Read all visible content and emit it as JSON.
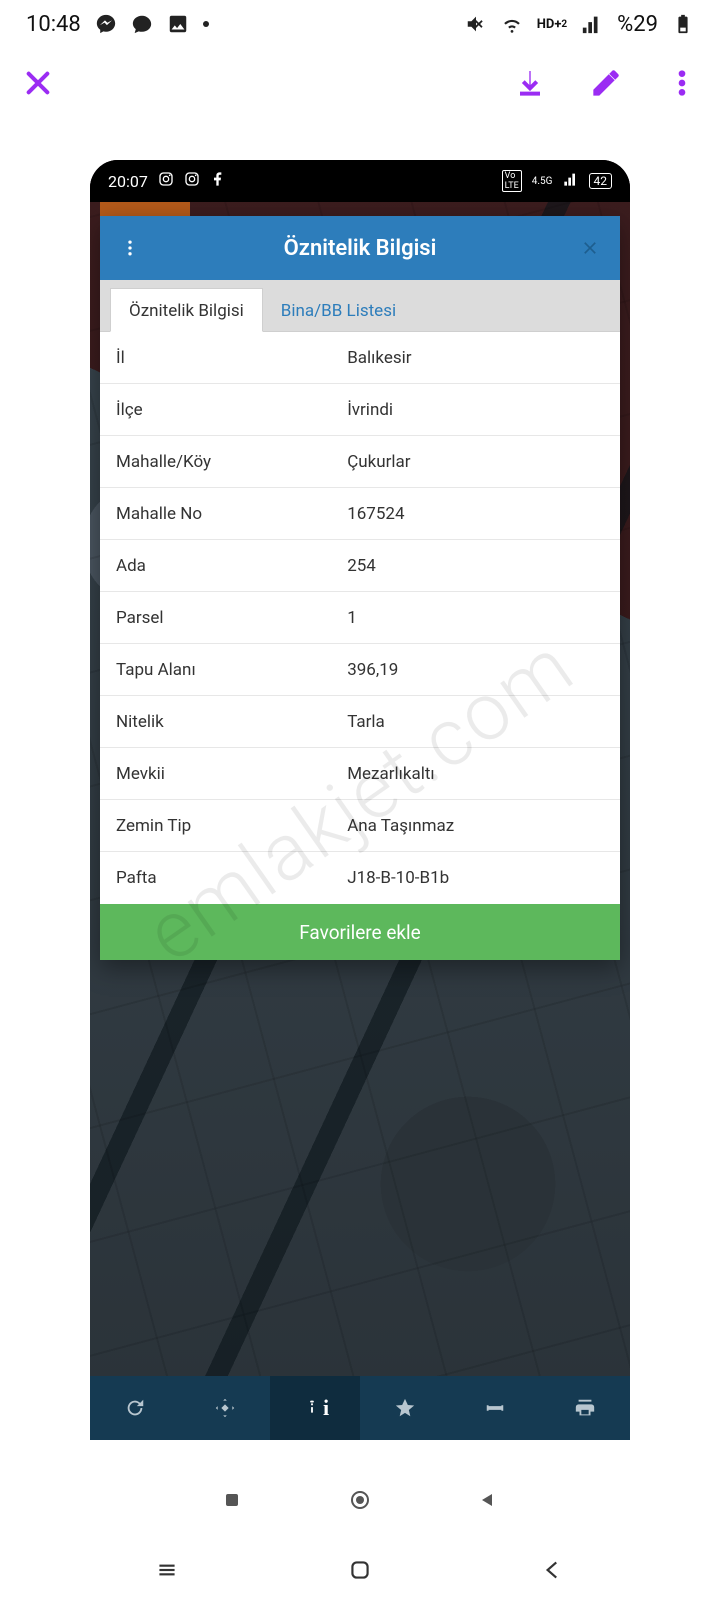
{
  "outer": {
    "time": "10:48",
    "battery_text": "%29"
  },
  "inner": {
    "time": "20:07",
    "battery_text": "42",
    "net_label": "4.5G"
  },
  "modal": {
    "title": "Öznitelik Bilgisi",
    "tabs": {
      "active": "Öznitelik Bilgisi",
      "other": "Bina/BB Listesi"
    },
    "rows": [
      {
        "key": "İl",
        "val": "Balıkesir"
      },
      {
        "key": "İlçe",
        "val": "İvrindi"
      },
      {
        "key": "Mahalle/Köy",
        "val": "Çukurlar"
      },
      {
        "key": "Mahalle No",
        "val": "167524"
      },
      {
        "key": "Ada",
        "val": "254"
      },
      {
        "key": "Parsel",
        "val": "1"
      },
      {
        "key": "Tapu Alanı",
        "val": "396,19"
      },
      {
        "key": "Nitelik",
        "val": "Tarla"
      },
      {
        "key": "Mevkii",
        "val": "Mezarlıkaltı"
      },
      {
        "key": "Zemin Tip",
        "val": "Ana Taşınmaz"
      },
      {
        "key": "Pafta",
        "val": "J18-B-10-B1b"
      }
    ],
    "fav_label": "Favorilere ekle"
  },
  "watermark": "emlakjet.com"
}
